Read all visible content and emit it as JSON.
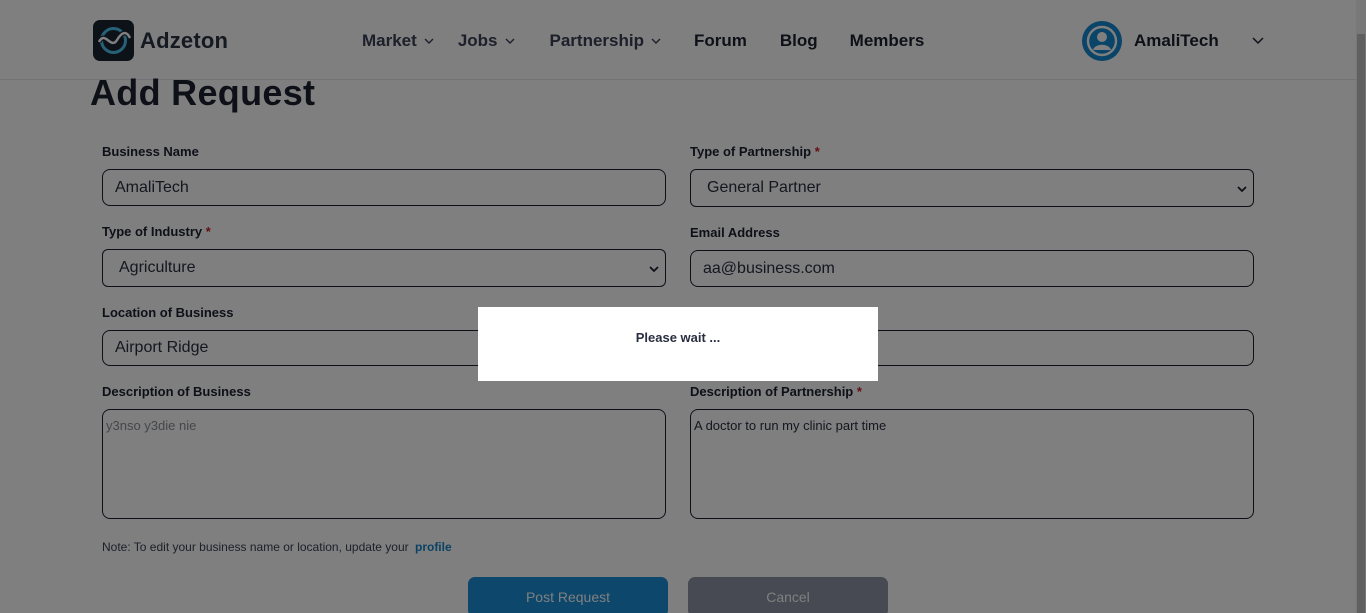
{
  "header": {
    "logo_text": "Adzeton",
    "nav": [
      {
        "label": "Market",
        "has_dropdown": true
      },
      {
        "label": "Jobs",
        "has_dropdown": true
      },
      {
        "label": "Partnership",
        "has_dropdown": true
      },
      {
        "label": "Forum",
        "has_dropdown": false
      },
      {
        "label": "Blog",
        "has_dropdown": false
      },
      {
        "label": "Members",
        "has_dropdown": false
      }
    ],
    "user_name": "AmaliTech"
  },
  "page": {
    "title": "Add Request"
  },
  "form": {
    "business_name": {
      "label": "Business Name",
      "value": "AmaliTech"
    },
    "partnership_type": {
      "label": "Type of Partnership",
      "required_mark": "*",
      "value": "General Partner"
    },
    "industry_type": {
      "label": "Type of Industry",
      "required_mark": "*",
      "value": "Agriculture"
    },
    "email": {
      "label": "Email Address",
      "value": "aa@business.com"
    },
    "location": {
      "label": "Location of Business",
      "value": "Airport Ridge"
    },
    "business_description": {
      "label": "Description of Business",
      "placeholder": "y3nso y3die nie"
    },
    "partnership_description": {
      "label": "Description of Partnership",
      "required_mark": "*",
      "value": "A doctor to run my clinic part time"
    },
    "note": {
      "text": "Note: To edit your business name or location, update your",
      "link": "profile"
    },
    "post_button": "Post Request",
    "cancel_button": "Cancel"
  },
  "modal": {
    "message": "Please wait ..."
  },
  "colors": {
    "accent": "#1a8fd6",
    "required": "#c81f2d",
    "text_dark": "#1c2031",
    "overlay": "rgba(0,0,0,0.5)"
  }
}
